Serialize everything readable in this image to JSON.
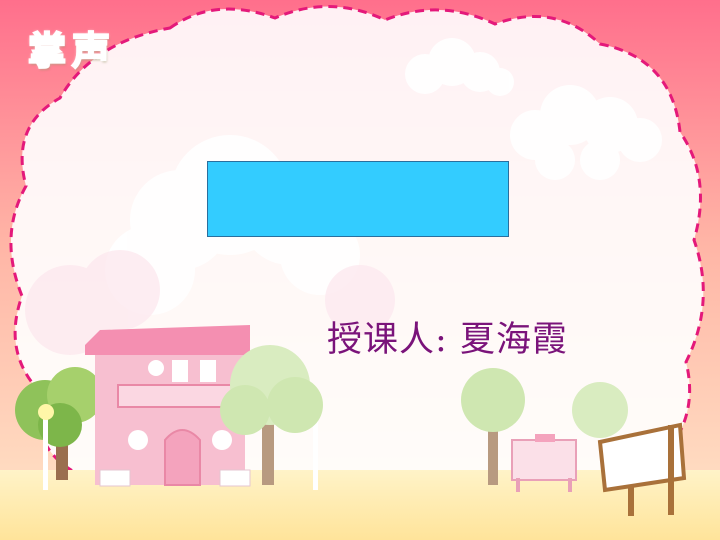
{
  "logo": {
    "text": "掌声"
  },
  "title_box": {
    "text": "",
    "color": "#33ccff"
  },
  "teacher": {
    "label": "授课人:",
    "name": "夏海霞",
    "color": "#7a137a"
  },
  "colors": {
    "background_top": "#ff6f8c",
    "background_bottom": "#ffe6c8",
    "cloud_border": "#e4197a",
    "cloud_fill": "#ffffff"
  }
}
